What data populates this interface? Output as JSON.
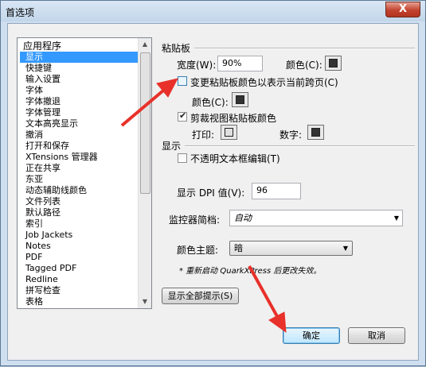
{
  "window": {
    "title": "首选项",
    "close_glyph": "X"
  },
  "sidebar": {
    "items": [
      {
        "label": "应用程序",
        "type": "category"
      },
      {
        "label": "显示",
        "type": "child",
        "selected": true
      },
      {
        "label": "快捷键",
        "type": "child"
      },
      {
        "label": "输入设置",
        "type": "child"
      },
      {
        "label": "字体",
        "type": "child"
      },
      {
        "label": "字体撤退",
        "type": "child"
      },
      {
        "label": "字体管理",
        "type": "child"
      },
      {
        "label": "文本高亮显示",
        "type": "child"
      },
      {
        "label": "撤消",
        "type": "child"
      },
      {
        "label": "打开和保存",
        "type": "child"
      },
      {
        "label": "XTensions 管理器",
        "type": "child"
      },
      {
        "label": "正在共享",
        "type": "child"
      },
      {
        "label": "东亚",
        "type": "child"
      },
      {
        "label": "动态辅助线颜色",
        "type": "child"
      },
      {
        "label": "文件列表",
        "type": "child"
      },
      {
        "label": "默认路径",
        "type": "child"
      },
      {
        "label": "索引",
        "type": "child"
      },
      {
        "label": "Job Jackets",
        "type": "child"
      },
      {
        "label": "Notes",
        "type": "child"
      },
      {
        "label": "PDF",
        "type": "child"
      },
      {
        "label": "Tagged PDF",
        "type": "child"
      },
      {
        "label": "Redline",
        "type": "child"
      },
      {
        "label": "拼写检查",
        "type": "child"
      },
      {
        "label": "表格",
        "type": "child"
      }
    ],
    "scroll_up": "▲",
    "scroll_down": "▼"
  },
  "pasteboard": {
    "group_label": "粘贴板",
    "width_label": "宽度(W):",
    "width_value": "90%",
    "color_label": "颜色(C):",
    "change_color_label": "变更粘贴板颜色以表示当前跨页(C)",
    "change_color_checked": false,
    "sub_color_label": "颜色(C):",
    "clip_view_label": "剪裁视图粘贴板颜色",
    "clip_view_checked": true,
    "print_label": "打印:",
    "digital_label": "数字:"
  },
  "display": {
    "group_label": "显示",
    "opaque_label": "不透明文本框编辑(T)",
    "opaque_checked": false,
    "dpi_label": "显示 DPI 值(V):",
    "dpi_value": "96",
    "monitor_label": "监控器简档:",
    "monitor_value": "自动",
    "theme_label": "颜色主题:",
    "theme_value": "暗",
    "dropdown_glyph": "▼",
    "restart_note": "* 重新启动 QuarkXPress 后更改失效。"
  },
  "buttons": {
    "show_tips": "显示全部提示(S)",
    "ok": "确定",
    "cancel": "取消"
  },
  "colors": {
    "selection": "#3399ff",
    "annotation_arrow": "#e8312a"
  }
}
